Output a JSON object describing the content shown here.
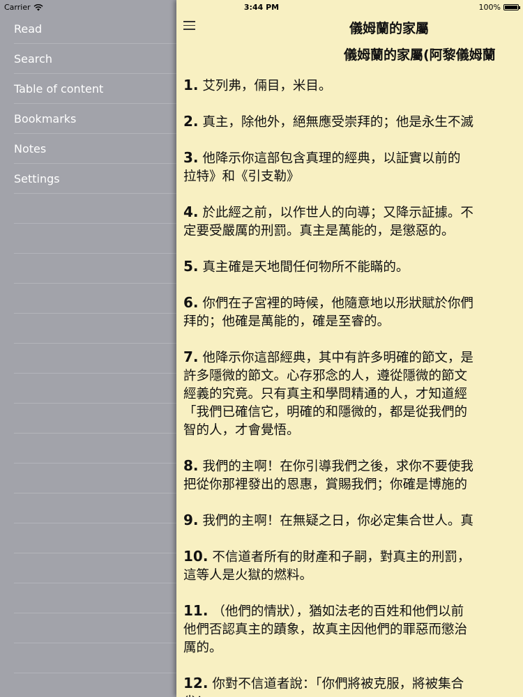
{
  "status_bar": {
    "carrier": "Carrier",
    "time": "3:44 PM",
    "battery": "100%"
  },
  "sidebar": {
    "items": [
      {
        "label": "Read"
      },
      {
        "label": "Search"
      },
      {
        "label": "Table of content"
      },
      {
        "label": "Bookmarks"
      },
      {
        "label": "Notes"
      },
      {
        "label": "Settings"
      }
    ]
  },
  "reader": {
    "nav_title": "儀姆蘭的家屬",
    "chapter_title": "儀姆蘭的家屬(阿黎儀姆蘭",
    "verses": [
      {
        "num": "1.",
        "lines": [
          "艾列弗，倆目，米目。"
        ]
      },
      {
        "num": "2.",
        "lines": [
          "真主，除他外，絕無應受崇拜的；他是永生不滅"
        ]
      },
      {
        "num": "3.",
        "lines": [
          "他降示你這部包含真理的經典，以証實以前的",
          "拉特》和《引支勒》"
        ]
      },
      {
        "num": "4.",
        "lines": [
          "於此經之前，以作世人的向導；又降示証據。不",
          "定要受嚴厲的刑罰。真主是萬能的，是懲惡的。"
        ]
      },
      {
        "num": "5.",
        "lines": [
          "真主確是天地間任何物所不能瞞的。"
        ]
      },
      {
        "num": "6.",
        "lines": [
          "你們在子宮裡的時候，他隨意地以形狀賦於你們",
          "拜的；他確是萬能的，確是至睿的。"
        ]
      },
      {
        "num": "7.",
        "lines": [
          "他降示你這部經典，其中有許多明確的節文，是",
          "許多隱微的節文。心存邪念的人，遵從隱微的節文",
          "經義的究竟。只有真主和學問精通的人，才知道經",
          "「我們已確信它，明確的和隱微的，都是從我們的",
          "智的人，才會覺悟。"
        ]
      },
      {
        "num": "8.",
        "lines": [
          "我們的主啊！在你引導我們之後，求你不要使我",
          "把從你那裡發出的恩惠，賞賜我們；你確是博施的"
        ]
      },
      {
        "num": "9.",
        "lines": [
          "我們的主啊！在無疑之日，你必定集合世人。真"
        ]
      },
      {
        "num": "10.",
        "lines": [
          "不信道者所有的財產和子嗣，對真主的刑罰，",
          "這等人是火獄的燃料。"
        ]
      },
      {
        "num": "11.",
        "lines": [
          "（他們的情狀），猶如法老的百姓和他們以前",
          "他們否認真主的蹟象，故真主因他們的罪惡而懲治",
          "厲的。"
        ]
      },
      {
        "num": "12.",
        "lines": [
          "你對不信道者說：「你們將被克服，將被集合",
          "劣！」"
        ]
      }
    ]
  }
}
